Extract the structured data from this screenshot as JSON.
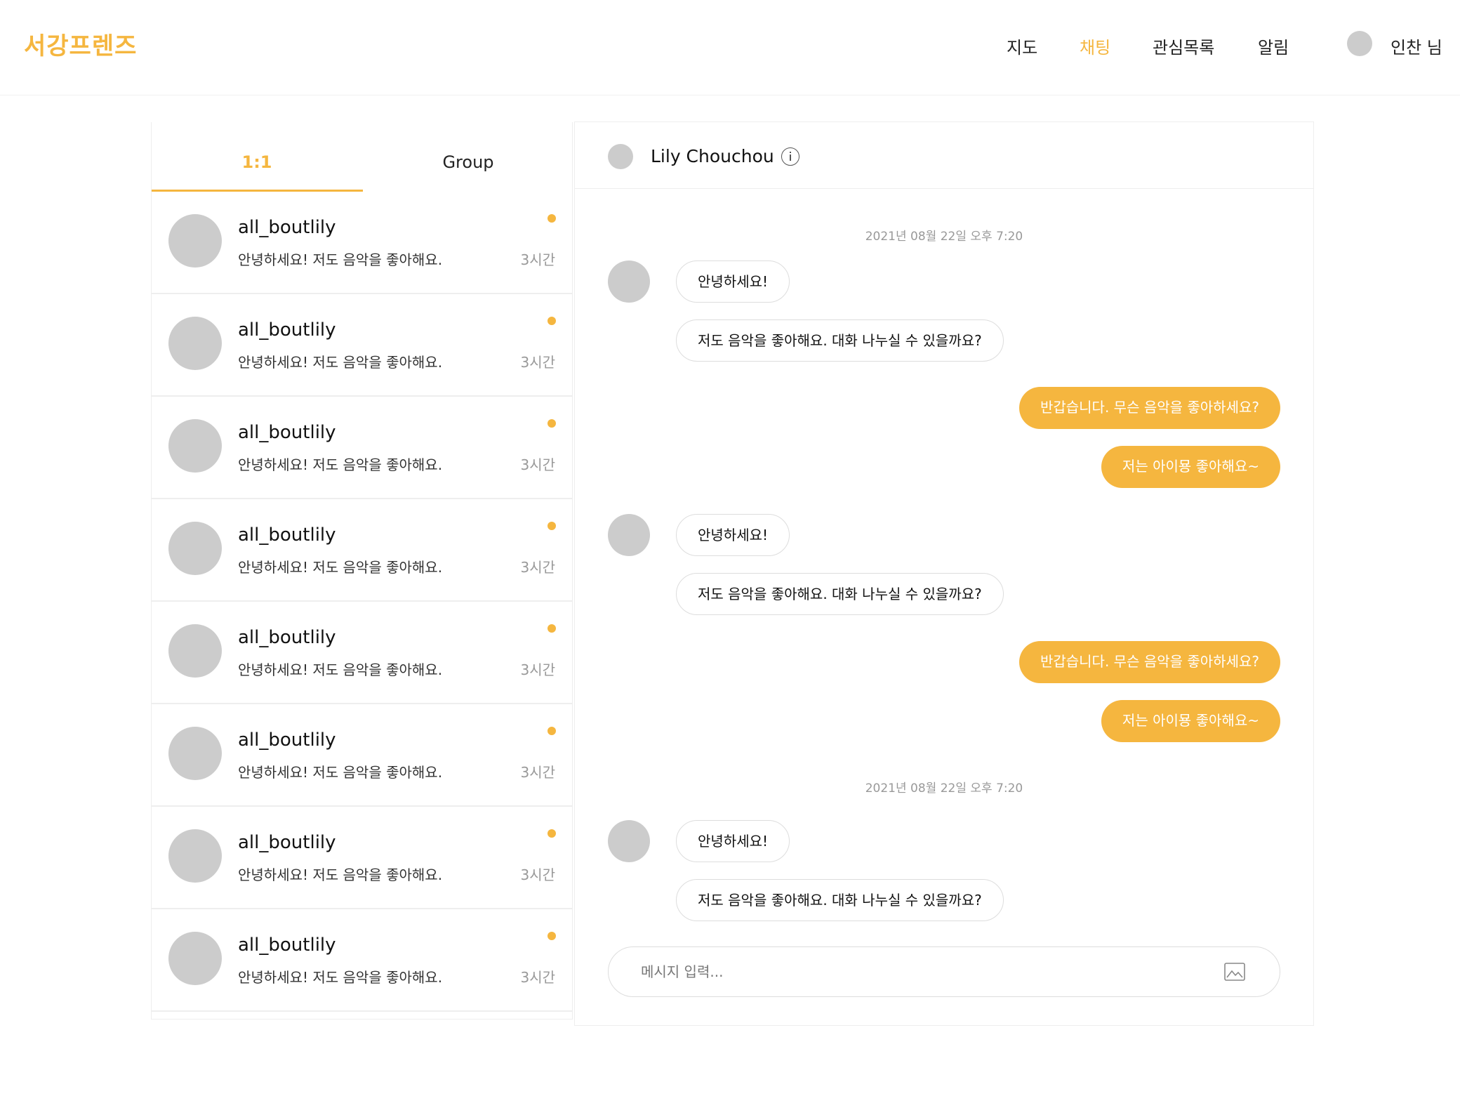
{
  "header": {
    "logo": "서강프렌즈",
    "nav": [
      "지도",
      "채팅",
      "관심목록",
      "알림"
    ],
    "active_nav": 1,
    "user": "인찬 님"
  },
  "tabs": [
    "1:1",
    "Group"
  ],
  "conversations": [
    {
      "name": "all_boutlily",
      "preview": "안녕하세요! 저도 음악을 좋아해요.",
      "time": "3시간"
    },
    {
      "name": "all_boutlily",
      "preview": "안녕하세요! 저도 음악을 좋아해요.",
      "time": "3시간"
    },
    {
      "name": "all_boutlily",
      "preview": "안녕하세요! 저도 음악을 좋아해요.",
      "time": "3시간"
    },
    {
      "name": "all_boutlily",
      "preview": "안녕하세요! 저도 음악을 좋아해요.",
      "time": "3시간"
    },
    {
      "name": "all_boutlily",
      "preview": "안녕하세요! 저도 음악을 좋아해요.",
      "time": "3시간"
    },
    {
      "name": "all_boutlily",
      "preview": "안녕하세요! 저도 음악을 좋아해요.",
      "time": "3시간"
    },
    {
      "name": "all_boutlily",
      "preview": "안녕하세요! 저도 음악을 좋아해요.",
      "time": "3시간"
    },
    {
      "name": "all_boutlily",
      "preview": "안녕하세요! 저도 음악을 좋아해요.",
      "time": "3시간"
    }
  ],
  "chat": {
    "title": "Lily Chouchou",
    "timestamps": [
      "2021년 08월 22일 오후 7:20",
      "2021년 08월 22일 오후 7:20"
    ],
    "messages": [
      "안녕하세요!",
      "저도 음악을 좋아해요. 대화 나누실 수 있을까요?",
      "반갑습니다. 무슨 음악을 좋아하세요?",
      "저는 아이묭 좋아해요~",
      "안녕하세요!",
      "저도 음악을 좋아해요. 대화 나누실 수 있을까요?",
      "반갑습니다. 무슨 음악을 좋아하세요?",
      "저는 아이묭 좋아해요~",
      "안녕하세요!",
      "저도 음악을 좋아해요. 대화 나누실 수 있을까요?"
    ],
    "input_placeholder": "메시지 입력...",
    "input_value": ""
  },
  "colors": {
    "accent": "#f5b63f",
    "avatar": "#cccccc",
    "border": "#eeeeee"
  },
  "icons": [
    "info-icon",
    "image-icon"
  ]
}
